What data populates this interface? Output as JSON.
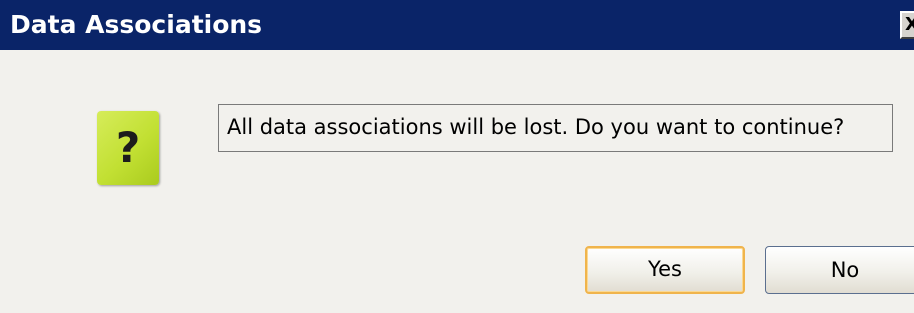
{
  "window": {
    "title": "Data Associations",
    "close_glyph": "X"
  },
  "icon": {
    "name": "question-icon",
    "glyph": "?",
    "color": "#c2e033"
  },
  "message": "All data associations will be lost. Do you want to continue?",
  "buttons": {
    "yes_label": "Yes",
    "no_label": "No"
  },
  "colors": {
    "titlebar": "#0a2468",
    "default_button_border": "#f0b44c"
  }
}
